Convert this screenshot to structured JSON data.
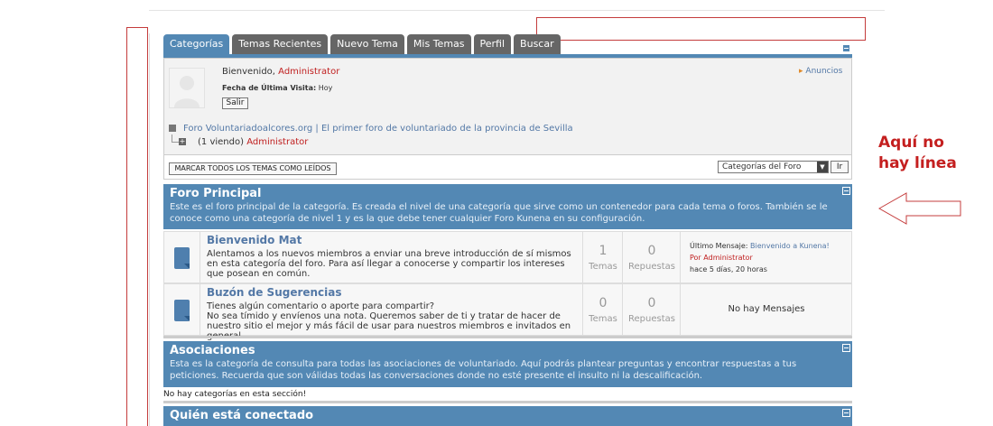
{
  "tabs": [
    "Categorías",
    "Temas Recientes",
    "Nuevo Tema",
    "Mis Temas",
    "Perfil",
    "Buscar"
  ],
  "profile": {
    "welcome": "Bienvenido,",
    "username": "Administrator",
    "last_visit_label": "Fecha de Última Visita:",
    "last_visit_value": "Hoy",
    "logout": "Salir",
    "announcements": "Anuncios"
  },
  "breadcrumb": {
    "forum_link": "Foro Voluntariadoalcores.org | El primer foro de voluntariado de la provincia de Sevilla",
    "viewing": "(1 viendo)",
    "viewing_user": "Administrator"
  },
  "toolbar": {
    "mark_read": "MARCAR TODOS LOS TEMAS COMO LEÍDOS",
    "category_select": "Categorías del Foro",
    "go": "Ir"
  },
  "sections": [
    {
      "title": "Foro Principal",
      "description": "Este es el foro principal de la categoría. Es creada el nivel de una categoría que sirve como un contenedor para cada tema o foros. También se le conoce como una categoría de nivel 1 y es la que debe tener cualquier Foro Kunena en su configuración.",
      "forums": [
        {
          "name": "Bienvenido Mat",
          "description": "Alentamos a los nuevos miembros a enviar una breve introducción de sí mismos en esta categoría del foro. Para así llegar a conocerse y compartir los intereses que posean en común.",
          "topics": "1",
          "topics_label": "Temas",
          "replies": "0",
          "replies_label": "Repuestas",
          "last_label": "Último Mensaje:",
          "last_title": "Bienvenido a Kunena!",
          "by_label": "Por",
          "by_user": "Administrator",
          "when": "hace 5 días, 20 horas"
        },
        {
          "name": "Buzón de Sugerencias",
          "description": "Tienes algún comentario o aporte para compartir?\nNo sea tímido y envíenos una nota. Queremos saber de ti y tratar de hacer de nuestro sitio el mejor y más fácil de usar para nuestros miembros e invitados en general.",
          "topics": "0",
          "topics_label": "Temas",
          "replies": "0",
          "replies_label": "Repuestas",
          "no_messages": "No hay Mensajes"
        }
      ]
    },
    {
      "title": "Asociaciones",
      "description": "Esta es la categoría de consulta para todas las asociaciones de voluntariado. Aquí podrás plantear preguntas y encontrar respuestas a tus peticiones. Recuerda que son válidas todas las conversaciones donde no esté presente el insulto ni la descalificación.",
      "empty": "No hay categorías en esta sección!"
    },
    {
      "title": "Quién está conectado"
    }
  ],
  "annotation": {
    "line1": "Aquí no",
    "line2": "hay línea"
  },
  "colors": {
    "accent": "#5388b4",
    "tab_inactive": "#666666",
    "annotation": "#c41f1f"
  }
}
